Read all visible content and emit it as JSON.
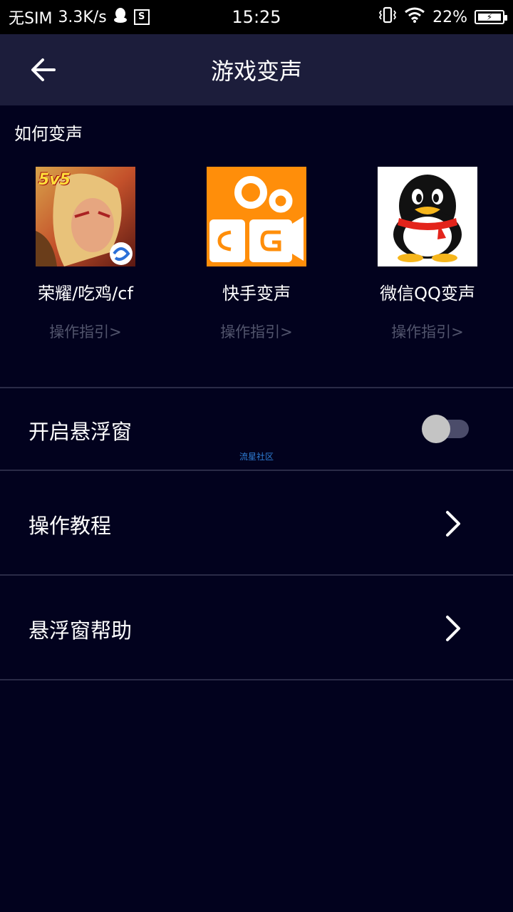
{
  "status_bar": {
    "carrier": "无SIM",
    "speed": "3.3K/s",
    "time": "15:25",
    "battery": "22%",
    "icons": [
      "qq-notification-icon",
      "s-box-icon",
      "vibrate-icon",
      "wifi-icon",
      "battery-charging-icon"
    ]
  },
  "header": {
    "title": "游戏变声",
    "back_icon": "arrow-left-icon"
  },
  "how_to": {
    "title": "如何变声",
    "apps": [
      {
        "name": "荣耀/吃鸡/cf",
        "link": "操作指引>",
        "icon": "honor-of-kings-icon",
        "badge": "5v5"
      },
      {
        "name": "快手变声",
        "link": "操作指引>",
        "icon": "kuaishou-icon"
      },
      {
        "name": "微信QQ变声",
        "link": "操作指引>",
        "icon": "qq-penguin-icon"
      }
    ]
  },
  "settings": {
    "floating_window": {
      "label": "开启悬浮窗",
      "enabled": false
    },
    "watermark": "流星社区",
    "tutorial": {
      "label": "操作教程"
    },
    "floating_help": {
      "label": "悬浮窗帮助"
    }
  },
  "colors": {
    "background": "#02021e",
    "header": "#1c1d3b",
    "divider": "#2a2b47",
    "link_text": "#51546c",
    "kuaishou_orange": "#ff8e0a"
  }
}
